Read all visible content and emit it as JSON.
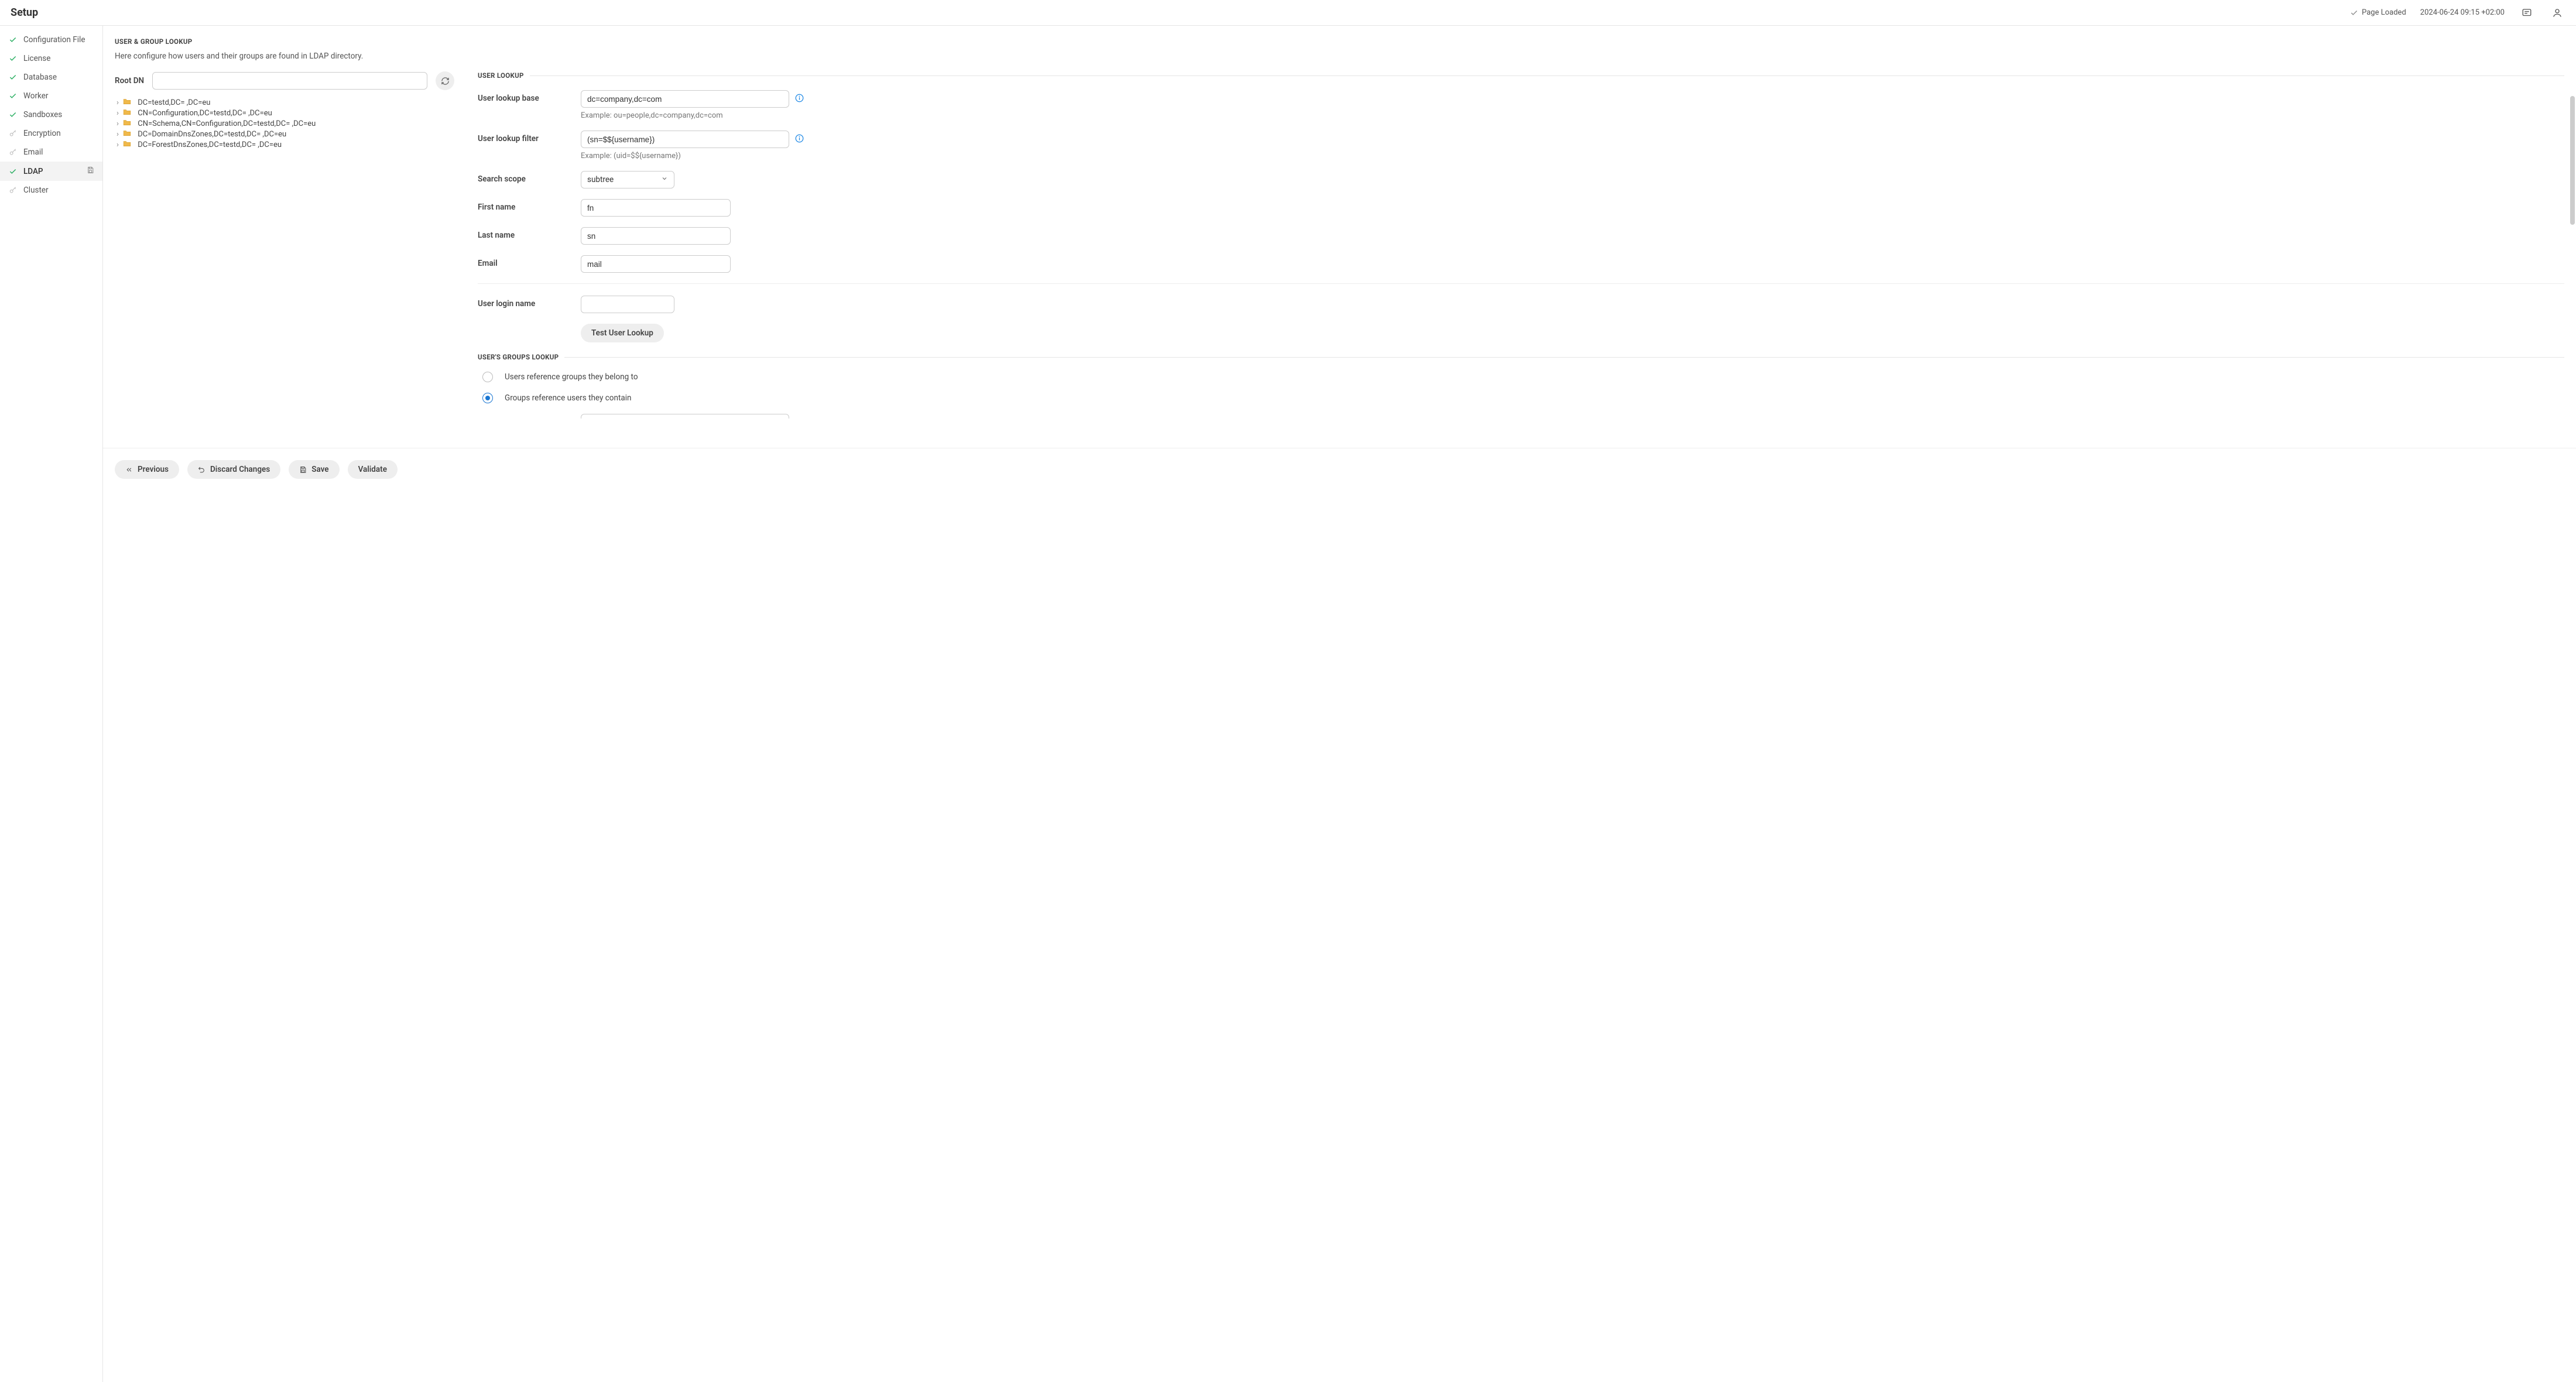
{
  "header": {
    "title": "Setup",
    "status_label": "Page Loaded",
    "timestamp": "2024-06-24 09:15 +02:00"
  },
  "sidebar": {
    "items": [
      {
        "label": "Configuration File",
        "kind": "check"
      },
      {
        "label": "License",
        "kind": "check"
      },
      {
        "label": "Database",
        "kind": "check"
      },
      {
        "label": "Worker",
        "kind": "check"
      },
      {
        "label": "Sandboxes",
        "kind": "check"
      },
      {
        "label": "Encryption",
        "kind": "key"
      },
      {
        "label": "Email",
        "kind": "key"
      },
      {
        "label": "LDAP",
        "kind": "check",
        "active": true,
        "dirty": true
      },
      {
        "label": "Cluster",
        "kind": "key"
      }
    ]
  },
  "main": {
    "section_title": "USER & GROUP LOOKUP",
    "subtitle": "Here configure how users and their groups are found in LDAP directory.",
    "root_dn_label": "Root DN",
    "root_dn_value": "",
    "tree": [
      "DC=testd,DC=        ,DC=eu",
      "CN=Configuration,DC=testd,DC=          ,DC=eu",
      "CN=Schema,CN=Configuration,DC=testd,DC=          ,DC=eu",
      "DC=DomainDnsZones,DC=testd,DC=          ,DC=eu",
      "DC=ForestDnsZones,DC=testd,DC=          ,DC=eu"
    ]
  },
  "user_lookup": {
    "panel_title": "USER LOOKUP",
    "base_label": "User lookup base",
    "base_value": "dc=company,dc=com",
    "base_hint": "Example: ou=people,dc=company,dc=com",
    "filter_label": "User lookup filter",
    "filter_value": "(sn=$${username})",
    "filter_hint": "Example: (uid=$${username})",
    "scope_label": "Search scope",
    "scope_value": "subtree",
    "first_name_label": "First name",
    "first_name_value": "fn",
    "last_name_label": "Last name",
    "last_name_value": "sn",
    "email_label": "Email",
    "email_value": "mail",
    "login_label": "User login name",
    "login_value": "",
    "test_btn": "Test User Lookup"
  },
  "groups_lookup": {
    "panel_title": "USER'S GROUPS LOOKUP",
    "opt1": "Users reference groups they belong to",
    "opt2": "Groups reference users they contain",
    "selected": "opt2"
  },
  "footer": {
    "previous": "Previous",
    "discard": "Discard Changes",
    "save": "Save",
    "validate": "Validate"
  }
}
